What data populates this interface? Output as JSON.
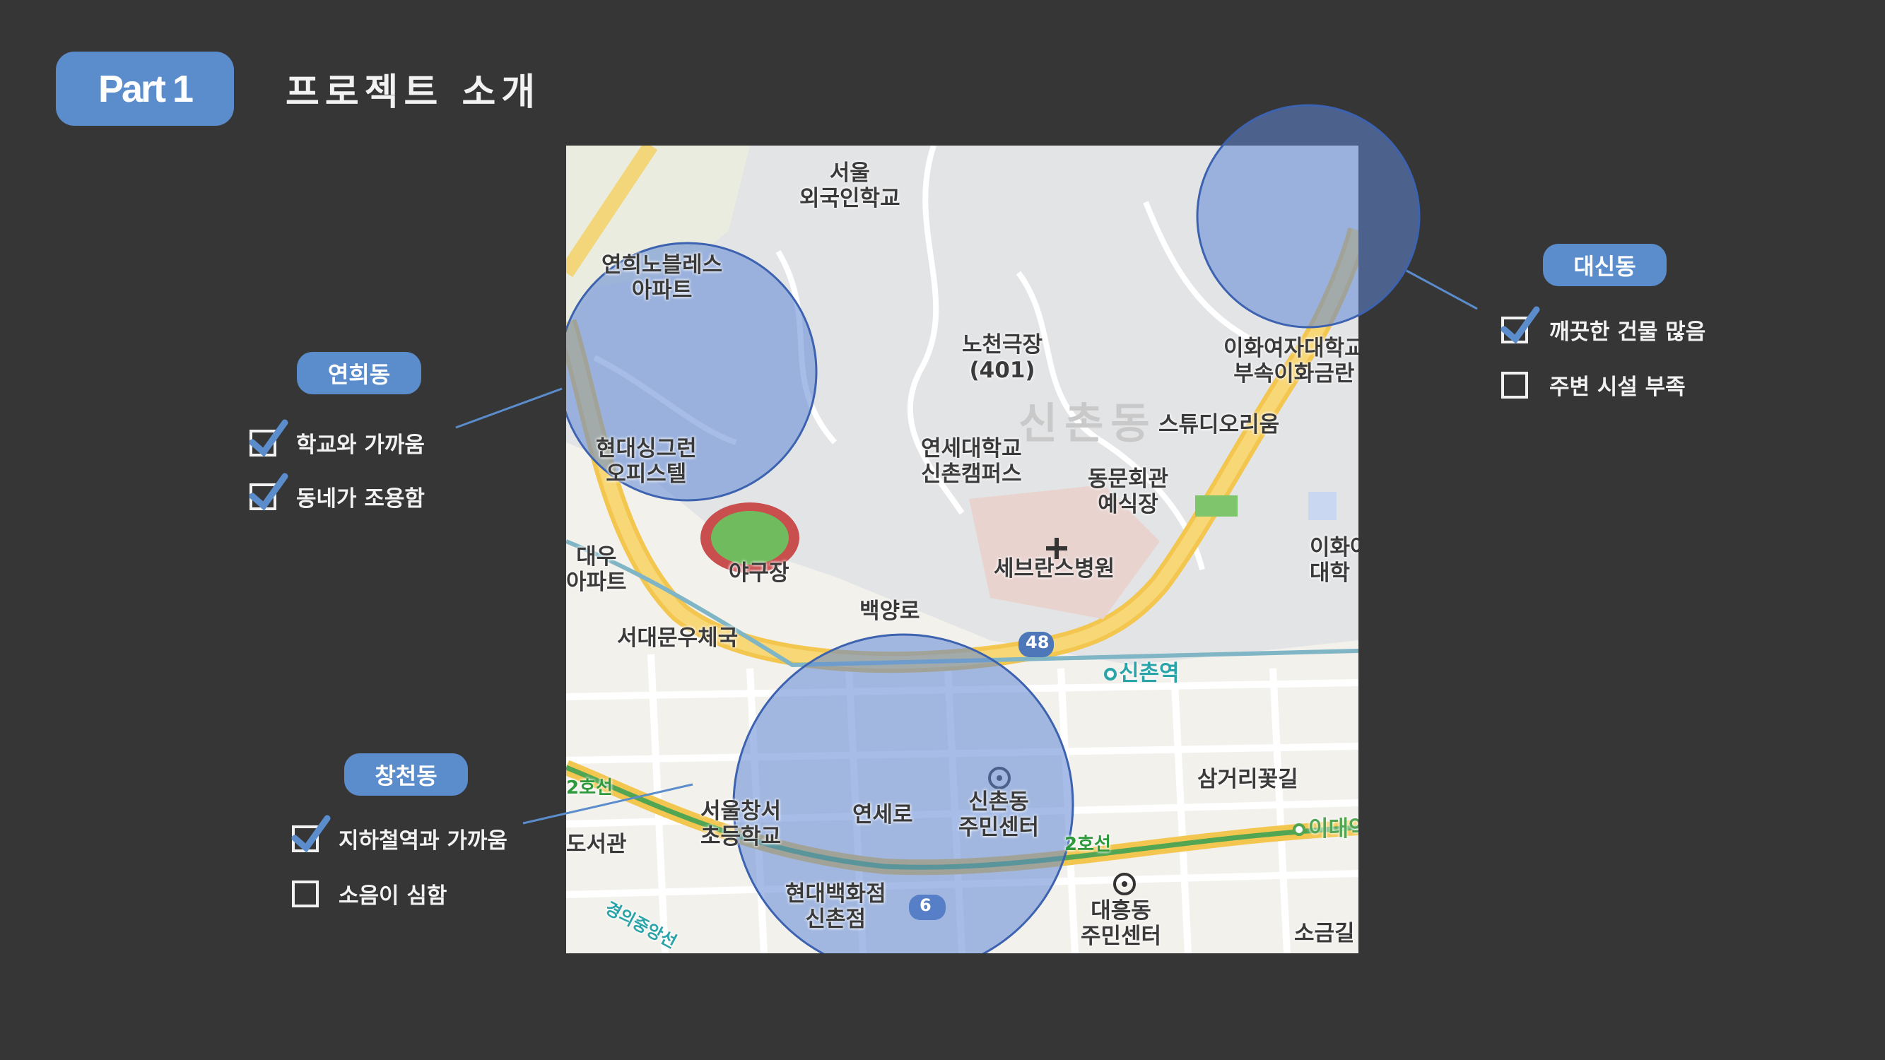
{
  "header": {
    "badge": "Part 1",
    "title": "프로젝트 소개"
  },
  "colors": {
    "background": "#363636",
    "accent": "#5b8ccb",
    "circle_fill": "#5f86d6",
    "text": "#f2f2f2"
  },
  "map": {
    "labels": {
      "seoul_foreign_school": "서울\n외국인학교",
      "yeonhui_noblesse": "연희노블레스\n아파트",
      "nocheon_theater": "노천극장\n(401)",
      "sinchon_dong": "신촌동",
      "studio_orium": "스튜디오리움",
      "ewha_affiliated": "이화여자대학교\n부속이화금란",
      "hyundai_single": "현대싱그런\n오피스텔",
      "yonsei_univ": "연세대학교\n신촌캠퍼스",
      "dongmun_hall": "동문회관\n예식장",
      "daewoo_apt": "대우\n아파트",
      "baseball_field": "야구장",
      "severance": "세브란스병원",
      "ewha_univ": "이화여\n대학",
      "baekyangro": "백양로",
      "seodaemun_post": "서대문우체국",
      "route_48": "48",
      "sinchon_station": "신촌역",
      "line2_left": "2호선",
      "samgeori": "삼거리꽃길",
      "seoul_changseo": "서울창서\n초등학교",
      "yonseiro": "연세로",
      "sinchon_center": "신촌동\n주민센터",
      "library": "도서관",
      "line2_right": "2호선",
      "idae": "이대역",
      "hyundai_dept": "현대백화점\n신촌점",
      "route_6": "6",
      "daeheung": "대흥동\n주민센터",
      "gyeongui": "경의중앙선",
      "sogeumgil": "소금길"
    }
  },
  "areas": {
    "daeshin": {
      "name": "대신동",
      "items": [
        {
          "label": "깨끗한 건물 많음",
          "checked": true
        },
        {
          "label": "주변 시설 부족",
          "checked": false
        }
      ]
    },
    "yeonhui": {
      "name": "연희동",
      "items": [
        {
          "label": "학교와 가까움",
          "checked": true
        },
        {
          "label": "동네가 조용함",
          "checked": true
        }
      ]
    },
    "changcheon": {
      "name": "창천동",
      "items": [
        {
          "label": "지하철역과 가까움",
          "checked": true
        },
        {
          "label": "소음이 심함",
          "checked": false
        }
      ]
    }
  }
}
